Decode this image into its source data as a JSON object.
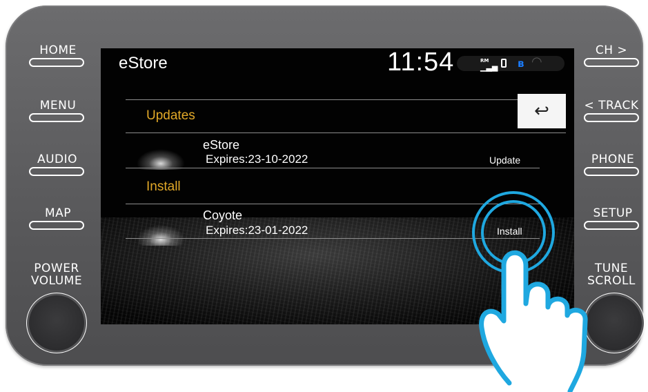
{
  "hardware": {
    "left": [
      "HOME",
      "MENU",
      "AUDIO",
      "MAP"
    ],
    "right": [
      "CH >",
      "< TRACK",
      "PHONE",
      "SETUP"
    ],
    "power_label": "POWER\nVOLUME",
    "tune_label": "TUNE\nSCROLL"
  },
  "header": {
    "title": "eStore",
    "clock": "11:54",
    "signal_label": "RM"
  },
  "sections": {
    "updates": {
      "label": "Updates",
      "item": {
        "name": "eStore",
        "expires": "Expires:23-10-2022",
        "action": "Update"
      }
    },
    "install": {
      "label": "Install",
      "item": {
        "name": "Coyote",
        "expires": "Expires:23-01-2022",
        "action": "Install"
      }
    }
  },
  "icons": {
    "back": "back-arrow-icon",
    "bluetooth": "bluetooth-icon",
    "wifi": "wifi-icon",
    "signal": "signal-icon",
    "phone": "phone-icon",
    "hand": "tap-hand-icon"
  },
  "colors": {
    "accent_section": "#e2a928",
    "touch_highlight": "#1fa8e0",
    "bluetooth": "#1a7cff",
    "bezel": "#5e5e60"
  }
}
